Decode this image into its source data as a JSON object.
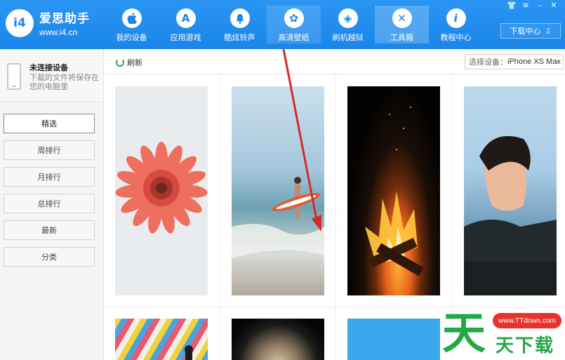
{
  "app": {
    "name": "爱思助手",
    "url": "www.i4.cn",
    "logo_glyph": "i4"
  },
  "nav": [
    {
      "label": "我的设备",
      "icon": "apple-icon",
      "glyph": ""
    },
    {
      "label": "应用游戏",
      "icon": "app-store-icon",
      "glyph": "A"
    },
    {
      "label": "酷炫铃声",
      "icon": "bell-icon",
      "glyph": "♪"
    },
    {
      "label": "高清壁纸",
      "icon": "flower-icon",
      "glyph": "✿"
    },
    {
      "label": "刷机越狱",
      "icon": "dropbox-icon",
      "glyph": "◈"
    },
    {
      "label": "工具箱",
      "icon": "tools-icon",
      "glyph": "✕"
    },
    {
      "label": "教程中心",
      "icon": "info-icon",
      "glyph": "i"
    }
  ],
  "window": {
    "shirt": "👕",
    "menu": "≡",
    "minimize": "–",
    "close": "✕"
  },
  "download": {
    "label": "下载中心",
    "icon": "download-icon",
    "glyph": "⇩"
  },
  "device": {
    "title": "未连接设备",
    "subtitle": "下载的文件将保存在您的电脑里"
  },
  "sidebar": {
    "items": [
      {
        "label": "精选",
        "selected": true
      },
      {
        "label": "周排行",
        "selected": false
      },
      {
        "label": "月排行",
        "selected": false
      },
      {
        "label": "总排行",
        "selected": false
      },
      {
        "label": "最新",
        "selected": false
      },
      {
        "label": "分类",
        "selected": false
      }
    ]
  },
  "toolbar": {
    "refresh_label": "刷新",
    "select_prefix": "选择设备：",
    "select_value": "iPhone XS Max",
    "caret": "⌄"
  },
  "wallpapers": [
    {
      "name": "wallpaper-pink-gerbera"
    },
    {
      "name": "wallpaper-surfer-beach"
    },
    {
      "name": "wallpaper-campfire"
    },
    {
      "name": "wallpaper-portrait-man"
    },
    {
      "name": "wallpaper-colorful-stripes"
    },
    {
      "name": "wallpaper-planet-dark"
    },
    {
      "name": "wallpaper-blue"
    }
  ],
  "watermark": {
    "big": "天",
    "pill": "www.TTdown.com",
    "small": "天下载"
  },
  "colors": {
    "header_blue": "#1f8ef1",
    "refresh_green": "#3aa14a",
    "arrow_red": "#d42a2a",
    "watermark_green": "#22a845",
    "watermark_red": "#e8322c"
  }
}
